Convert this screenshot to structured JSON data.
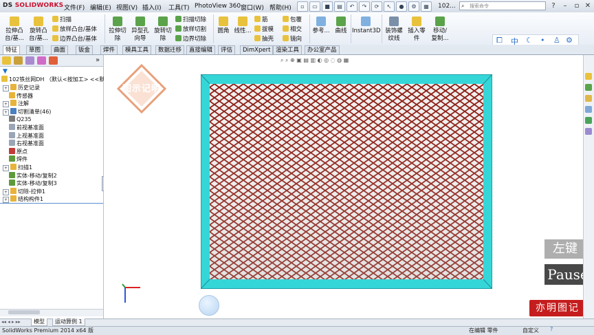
{
  "app": {
    "logo_prefix": "DS",
    "logo_name": "SOLIDWORKS",
    "doc_title": "102...",
    "search_placeholder": "搜索命令",
    "menus": [
      "文件(F)",
      "编辑(E)",
      "视图(V)",
      "插入(I)",
      "工具(T)",
      "PhotoView 360",
      "窗口(W)",
      "帮助(H)"
    ]
  },
  "ribbon": {
    "big": [
      {
        "label1": "拉伸凸",
        "label2": "台/基..."
      },
      {
        "label1": "旋转凸",
        "label2": "台/基..."
      },
      {
        "label1": "拉伸切",
        "label2": "除"
      },
      {
        "label1": "异型孔",
        "label2": "向导"
      },
      {
        "label1": "旋转切",
        "label2": "除"
      },
      {
        "label1": "圆角",
        "label2": ""
      },
      {
        "label1": "线性...",
        "label2": ""
      },
      {
        "label1": "参考...",
        "label2": ""
      },
      {
        "label1": "曲线",
        "label2": ""
      },
      {
        "label1": "Instant3D",
        "label2": ""
      },
      {
        "label1": "装饰螺",
        "label2": "纹线"
      },
      {
        "label1": "插入零",
        "label2": "件"
      },
      {
        "label1": "移动/",
        "label2": "复制..."
      }
    ],
    "small_col1": [
      "扫描",
      "放样凸台/基体",
      "边界凸台/基体"
    ],
    "small_col2": [
      "扫描切除",
      "放样切割",
      "边界切除"
    ],
    "small_col3": [
      "筋",
      "拔模",
      "抽壳"
    ],
    "small_col4": [
      "包覆",
      "相交",
      "镜向"
    ]
  },
  "tabs": [
    "特征",
    "草图",
    "曲面",
    "钣金",
    "焊件",
    "模具工具",
    "数据迁移",
    "直接编辑",
    "评估",
    "DimXpert",
    "渲染工具",
    "办公室产品"
  ],
  "active_tab": "特征",
  "tree": {
    "root": "102铁丝网DH （默认<按加工> <<默认>",
    "items": [
      {
        "label": "历史记录",
        "expand": true,
        "color": "#e8b33a"
      },
      {
        "label": "传感器",
        "expand": false,
        "color": "#e8b33a"
      },
      {
        "label": "注解",
        "expand": true,
        "color": "#e8b33a"
      },
      {
        "label": "切割清单(46)",
        "expand": true,
        "color": "#4a7fc1"
      },
      {
        "label": "Q235",
        "expand": false,
        "color": "#7a7a7a"
      },
      {
        "label": "前视基准面",
        "expand": false,
        "color": "#9aa6b6"
      },
      {
        "label": "上视基准面",
        "expand": false,
        "color": "#9aa6b6"
      },
      {
        "label": "右视基准面",
        "expand": false,
        "color": "#9aa6b6"
      },
      {
        "label": "原点",
        "expand": false,
        "color": "#c23a3a"
      },
      {
        "label": "焊件",
        "expand": false,
        "color": "#5e9a3a"
      },
      {
        "label": "扫描1",
        "expand": true,
        "color": "#e8b33a"
      },
      {
        "label": "实体-移动/复制2",
        "expand": false,
        "color": "#5e9a3a"
      },
      {
        "label": "实体-移动/复制3",
        "expand": false,
        "color": "#5e9a3a"
      },
      {
        "label": "切除-拉伸1",
        "expand": true,
        "color": "#e8b33a"
      },
      {
        "label": "结构构件1",
        "expand": true,
        "color": "#e8b33a"
      }
    ]
  },
  "bottom_tabs": [
    "模型",
    "运动算例 1"
  ],
  "status": {
    "left": "SolidWorks Premium 2014 x64 版",
    "mode": "在编辑 零件",
    "units": "自定义"
  },
  "overlay": {
    "stamp_text": "图示记明",
    "key_label": "左键",
    "pause_label": "Pause",
    "brand_stamp": "亦明图记"
  },
  "lang_bar": [
    "中",
    "☾",
    "•",
    "⚙"
  ],
  "colors": {
    "frame_cyan": "#35d6d8",
    "mesh_red": "#8b1a10",
    "ribbon_bg": "#eef2f7"
  }
}
